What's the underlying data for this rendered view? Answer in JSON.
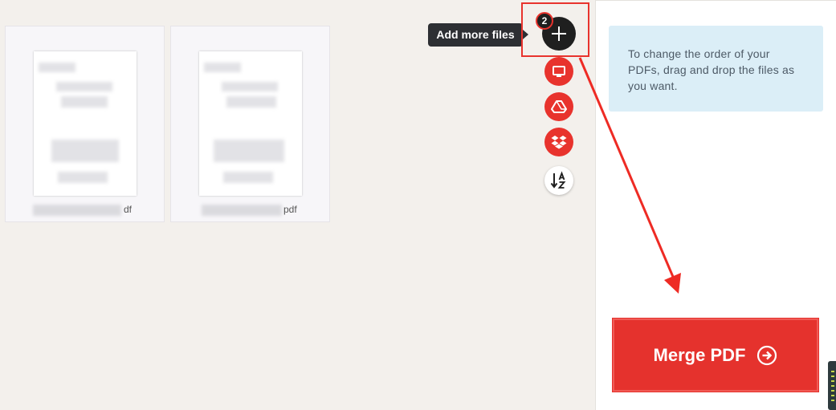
{
  "files": [
    {
      "ext_label": "df"
    },
    {
      "ext_label": "pdf"
    }
  ],
  "toolbar": {
    "add_more_tooltip": "Add more files",
    "file_count": "2",
    "buttons": [
      {
        "name": "upload-from-computer",
        "icon": "monitor-icon"
      },
      {
        "name": "upload-from-google-drive",
        "icon": "google-drive-icon"
      },
      {
        "name": "upload-from-dropbox",
        "icon": "dropbox-icon"
      },
      {
        "name": "sort-alphabetically",
        "icon": "sort-az-icon"
      }
    ]
  },
  "sidebar": {
    "help_text": "To change the order of your PDFs, drag and drop the files as you want.",
    "merge_button_label": "Merge PDF"
  },
  "colors": {
    "accent": "#e5322d",
    "dark": "#1f1f1f",
    "help_bg": "#dbeef7",
    "workspace_bg": "#f3f0ec"
  }
}
